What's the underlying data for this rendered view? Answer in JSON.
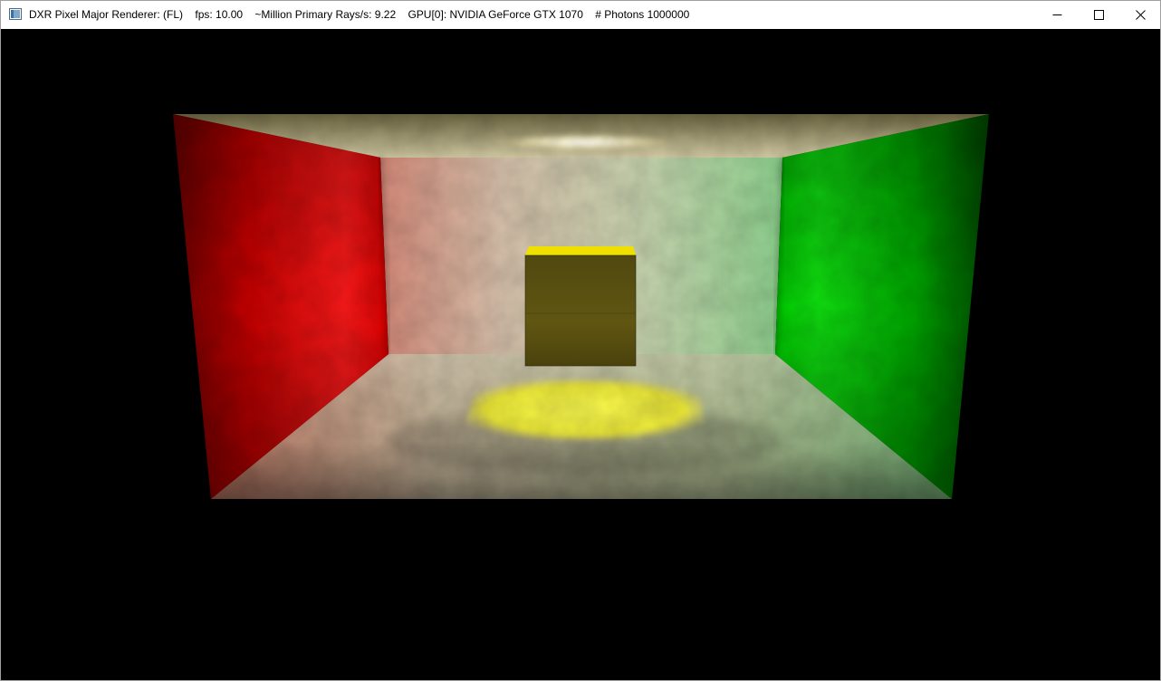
{
  "window": {
    "title": "DXR Pixel Major Renderer: (FL)    fps: 10.00    ~Million Primary Rays/s: 9.22    GPU[0]: NVIDIA GeForce GTX 1070    # Photons 1000000",
    "app_icon": "app-window-icon",
    "buttons": {
      "minimize_icon": "minimize-icon",
      "maximize_icon": "maximize-icon",
      "close_icon": "close-icon"
    }
  },
  "scene": {
    "description_icon": "cornell-box-render",
    "colors": {
      "left_wall": "#e00000",
      "right_wall": "#00c800",
      "back_wall": "#c8c0a0",
      "floor": "#d0c8b0",
      "ceiling_light": "#fff8d0",
      "cube": "#5a5010",
      "cube_top": "#f0e000",
      "floor_caustic": "#f4f040",
      "background": "#000000"
    }
  }
}
